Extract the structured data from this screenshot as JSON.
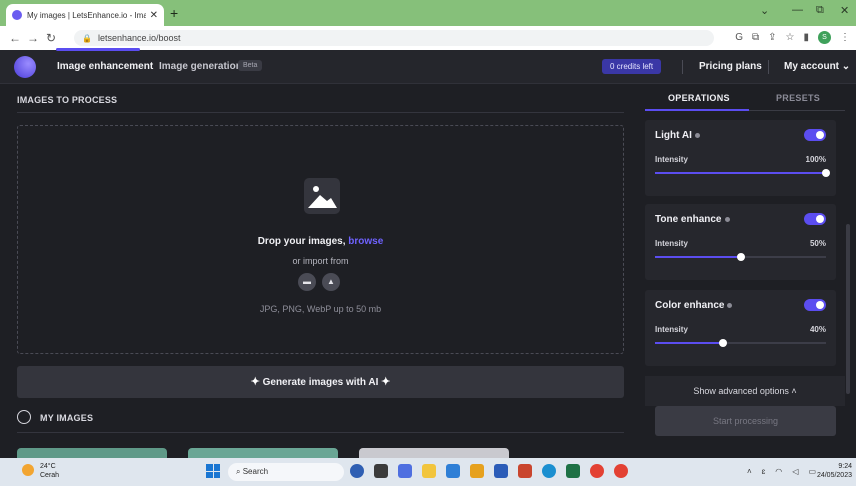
{
  "browser": {
    "tab_title": "My images | LetsEnhance.io - Ima",
    "url": "letsenhance.io/boost",
    "profile_initial": "S"
  },
  "header": {
    "nav_enhance": "Image enhancement",
    "nav_generation": "Image generation",
    "beta": "Beta",
    "credits": "0 credits left",
    "pricing": "Pricing plans",
    "account": "My account"
  },
  "main": {
    "images_title": "IMAGES TO PROCESS",
    "drop_prefix": "Drop your images, ",
    "drop_browse": "browse",
    "import_from": "or import from",
    "formats": "JPG, PNG, WebP up to 50 mb",
    "generate": "Generate images with AI",
    "my_images": "MY IMAGES"
  },
  "panel": {
    "tabs": [
      "OPERATIONS",
      "PRESETS"
    ],
    "cards": [
      {
        "title": "Light AI",
        "label": "Intensity",
        "value": "100%",
        "level": 1.0,
        "enabled": true
      },
      {
        "title": "Tone enhance",
        "label": "Intensity",
        "value": "50%",
        "level": 0.5,
        "enabled": true
      },
      {
        "title": "Color enhance",
        "label": "Intensity",
        "value": "40%",
        "level": 0.4,
        "enabled": true
      }
    ],
    "advanced": "Show advanced options",
    "start": "Start processing"
  },
  "taskbar": {
    "temp": "24°C",
    "condition": "Cerah",
    "search": "Search",
    "time": "9:24",
    "date": "24/05/2023"
  },
  "colors": {
    "accent": "#5b4df0",
    "background": "#1e1f24",
    "card": "#26272d"
  }
}
